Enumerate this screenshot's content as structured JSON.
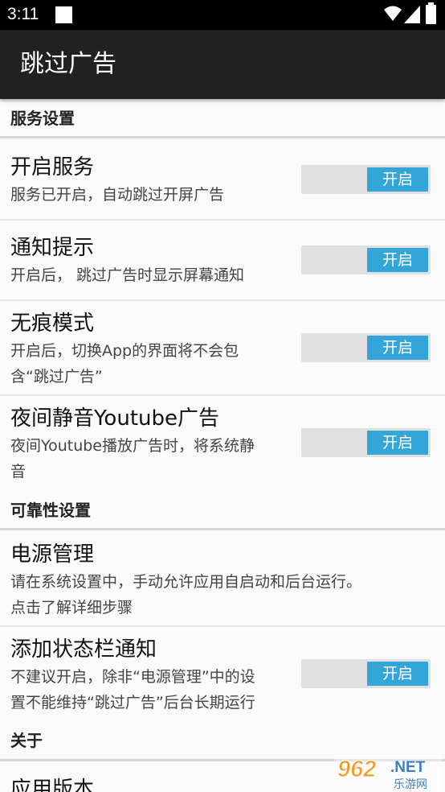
{
  "status_bar": {
    "time": "3:11"
  },
  "app_bar": {
    "title": "跳过广告"
  },
  "sections": {
    "service": {
      "header": "服务设置"
    },
    "reliability": {
      "header": "可靠性设置"
    },
    "about": {
      "header": "关于"
    }
  },
  "prefs": {
    "enable_service": {
      "title": "开启服务",
      "summary": "服务已开启，自动跳过开屏广告",
      "toggle_label": "开启"
    },
    "notification": {
      "title": "通知提示",
      "summary": "开启后， 跳过广告时显示屏幕通知",
      "toggle_label": "开启"
    },
    "incognito": {
      "title": "无痕模式",
      "summary_line1": "开启后，切换App的界面将不会包",
      "summary_line2": "含“跳过广告”",
      "toggle_label": "开启"
    },
    "night_mute": {
      "title": "夜间静音Youtube广告",
      "summary_line1": "夜间Youtube播放广告时，将系统静",
      "summary_line2": "音",
      "toggle_label": "开启"
    },
    "power": {
      "title": "电源管理",
      "summary_line1": "请在系统设置中，手动允许应用自启动和后台运行。",
      "summary_line2": "点击了解详细步骤"
    },
    "statusbar_notif": {
      "title": "添加状态栏通知",
      "summary_line1": "不建议开启，除非“电源管理”中的设",
      "summary_line2": "置不能维持“跳过广告”后台长期运行",
      "toggle_label": "开启"
    },
    "app_version": {
      "title": "应用版本"
    }
  },
  "watermark": {
    "brand": "962",
    "suffix": ".NET",
    "subtitle": "乐游网"
  },
  "colors": {
    "app_bar": "#212121",
    "status_bar": "#000000",
    "toggle_accent": "#33a5d8",
    "toggle_track": "#e0e0e0",
    "watermark_orange": "#f39a1e"
  }
}
